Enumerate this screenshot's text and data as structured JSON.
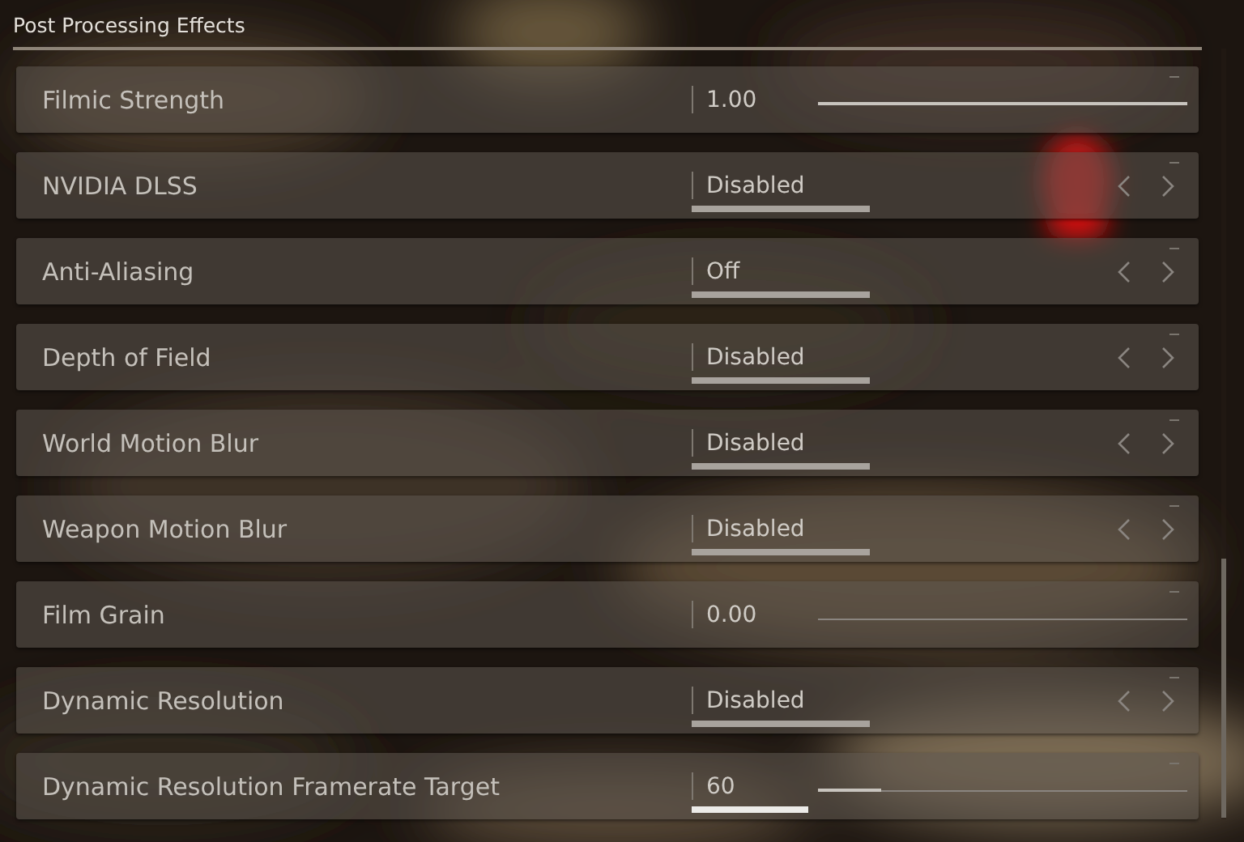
{
  "section": {
    "title": "Post Processing Effects"
  },
  "settings": [
    {
      "label": "Filmic Strength",
      "kind": "slider",
      "value": "1.00",
      "level": 1.0,
      "highlighted": false
    },
    {
      "label": "NVIDIA DLSS",
      "kind": "option",
      "value": "Disabled",
      "highlighted": false
    },
    {
      "label": "Anti-Aliasing",
      "kind": "option",
      "value": "Off",
      "highlighted": false
    },
    {
      "label": "Depth of Field",
      "kind": "option",
      "value": "Disabled",
      "highlighted": false
    },
    {
      "label": "World Motion Blur",
      "kind": "option",
      "value": "Disabled",
      "highlighted": false
    },
    {
      "label": "Weapon Motion Blur",
      "kind": "option",
      "value": "Disabled",
      "highlighted": false
    },
    {
      "label": "Film Grain",
      "kind": "slider",
      "value": "0.00",
      "highlighted": false
    },
    {
      "label": "Dynamic Resolution",
      "kind": "option",
      "value": "Disabled",
      "highlighted": false
    },
    {
      "label": "Dynamic Resolution Framerate Target",
      "kind": "slider",
      "value": "60",
      "level": 0.17,
      "highlighted": true
    }
  ]
}
